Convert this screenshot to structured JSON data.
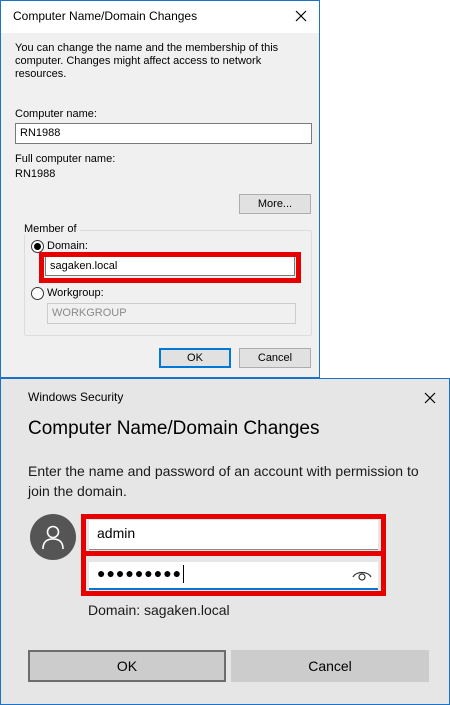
{
  "dialog1": {
    "title": "Computer Name/Domain Changes",
    "intro": "You can change the name and the membership of this computer. Changes might affect access to network resources.",
    "computer_name_label": "Computer name:",
    "computer_name_value": "RN1988",
    "full_name_label": "Full computer name:",
    "full_name_value": "RN1988",
    "more_button": "More...",
    "member_of_label": "Member of",
    "domain_label": "Domain:",
    "domain_value": "sagaken.local",
    "domain_selected": true,
    "workgroup_label": "Workgroup:",
    "workgroup_value": "WORKGROUP",
    "ok_button": "OK",
    "cancel_button": "Cancel"
  },
  "dialog2": {
    "window_title": "Windows Security",
    "heading": "Computer Name/Domain Changes",
    "description": "Enter the name and password of an account with permission to join the domain.",
    "username_value": "admin",
    "password_masked": "●●●●●●●●●",
    "domain_line": "Domain: sagaken.local",
    "ok_button": "OK",
    "cancel_button": "Cancel"
  },
  "icons": {
    "close": "close-icon",
    "avatar": "user-avatar-icon",
    "reveal_password": "eye-icon"
  },
  "colors": {
    "highlight": "#e60000",
    "accent": "#0078d7",
    "window_border": "#1a73c8"
  }
}
